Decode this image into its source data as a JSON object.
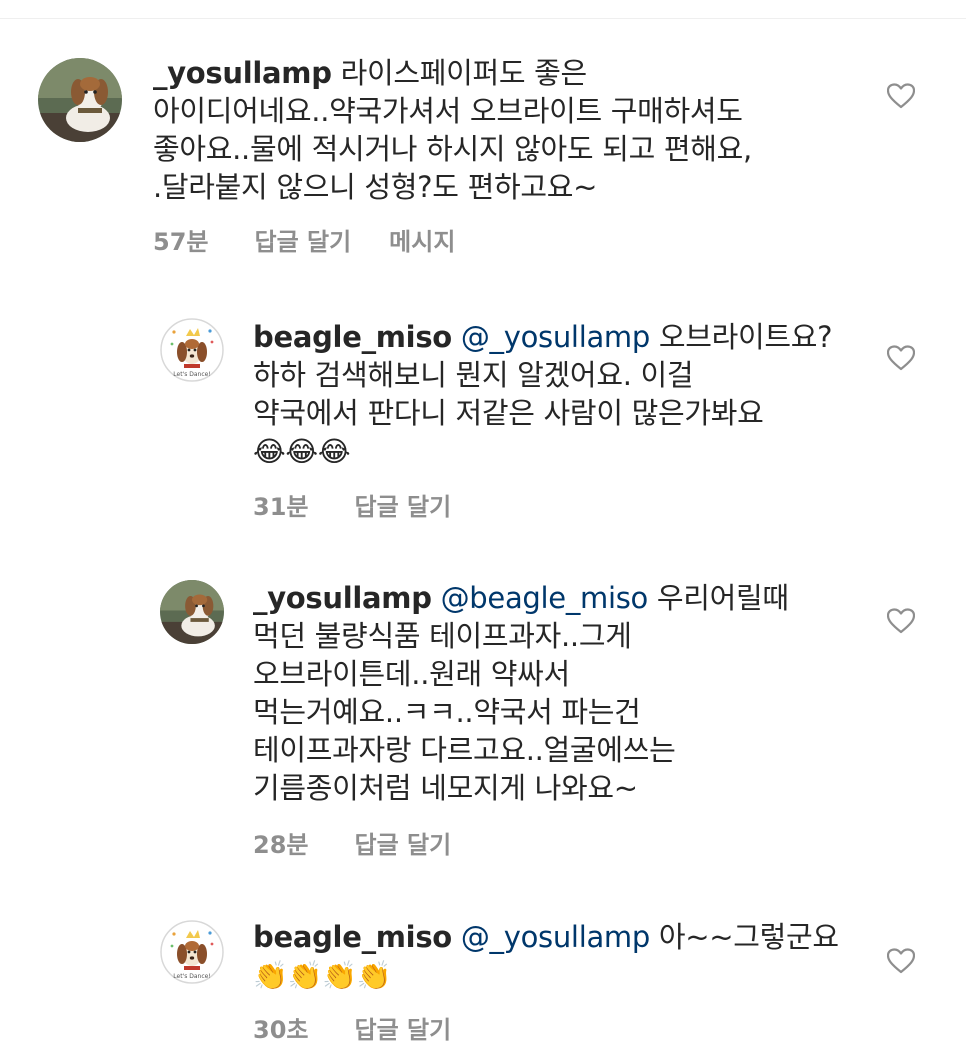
{
  "comments": [
    {
      "username": "_yosullamp",
      "mention": "",
      "lines": [
        "라이스페이퍼도 좋은",
        "아이디어네요..약국가셔서 오브라이트  구매하셔도",
        "좋아요..물에 적시거나 하시지 않아도 되고 편해요,",
        ".달라붙지 않으니  성형?도 편하고요~"
      ],
      "emoji": "",
      "time": "57분",
      "reply_label": "답글 달기",
      "message_label": "메시지"
    },
    {
      "username": "beagle_miso",
      "mention": "@_yosullamp",
      "lines": [
        "오브라이트요?",
        "하하 검색해보니 뭔지 알겠어요. 이걸",
        "약국에서 판다니 저같은 사람이 많은가봐요"
      ],
      "emoji": "😂😂😂",
      "time": "31분",
      "reply_label": "답글 달기"
    },
    {
      "username": "_yosullamp",
      "mention": "@beagle_miso",
      "lines": [
        "우리어릴때",
        "먹던 불량식품 테이프과자..그게",
        "오브라이튼데..원래 약싸서",
        "먹는거예요..ㅋㅋ..약국서 파는건",
        "테이프과자랑 다르고요..얼굴에쓰는",
        "기름종이처럼 네모지게 나와요~"
      ],
      "emoji": "",
      "time": "28분",
      "reply_label": "답글 달기"
    },
    {
      "username": "beagle_miso",
      "mention": "@_yosullamp",
      "lines": [
        "아~~그렇군요"
      ],
      "emoji": "👏👏👏👏",
      "time": "30초",
      "reply_label": "답글 달기"
    }
  ],
  "icons": {
    "like": "heart-outline-icon",
    "avatar_dog": "dog-photo-avatar",
    "avatar_beagle": "beagle-illustration-avatar"
  },
  "colors": {
    "text": "#262626",
    "mention": "#00376b",
    "meta": "#8e8e8e"
  }
}
